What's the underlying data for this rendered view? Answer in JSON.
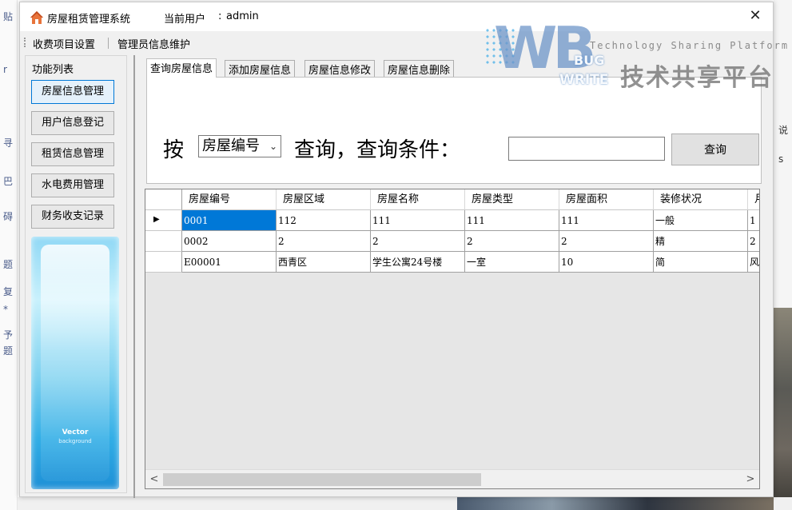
{
  "background": {
    "left_fragments": [
      "贴",
      "r",
      "寻",
      "巴",
      "碍",
      "题",
      "复",
      "*",
      "予",
      "题"
    ],
    "right_fragments": [
      "说",
      "s"
    ]
  },
  "window": {
    "title": "房屋租赁管理系统",
    "user_label": "当前用户",
    "user_separator": ":",
    "user_name": "admin",
    "close_glyph": "✕"
  },
  "menu": {
    "items": [
      {
        "label": "收费项目设置"
      },
      {
        "label": "管理员信息维护"
      }
    ]
  },
  "sidebar": {
    "title": "功能列表",
    "items": [
      {
        "label": "房屋信息管理",
        "active": true
      },
      {
        "label": "用户信息登记"
      },
      {
        "label": "租赁信息管理"
      },
      {
        "label": "水电费用管理"
      },
      {
        "label": "财务收支记录"
      }
    ],
    "banner": {
      "line1": "Vector",
      "line2": "background"
    }
  },
  "tabs": [
    {
      "label": "查询房屋信息",
      "active": true
    },
    {
      "label": "添加房屋信息"
    },
    {
      "label": "房屋信息修改"
    },
    {
      "label": "房屋信息删除"
    }
  ],
  "query": {
    "by_label": "按",
    "field_selected": "房屋编号",
    "condition_label": "查询，查询条件：",
    "input_value": "",
    "button_label": "查询"
  },
  "grid": {
    "columns": [
      "房屋编号",
      "房屋区域",
      "房屋名称",
      "房屋类型",
      "房屋面积",
      "装修状况",
      "月"
    ],
    "rows": [
      [
        "0001",
        "112",
        "111",
        "111",
        "111",
        "一般",
        "1"
      ],
      [
        "0002",
        "2",
        "2",
        "2",
        "2",
        "精",
        "2"
      ],
      [
        "E00001",
        "西青区",
        "学生公寓24号楼",
        "一室",
        "10",
        "简",
        "风"
      ]
    ],
    "current_row_marker": "▶",
    "scroll_left": "<",
    "scroll_right": ">"
  },
  "watermark": {
    "tagline": "Technology Sharing Platform",
    "bug": "BUG",
    "write": "WRITE",
    "cn": "技术共享平台"
  },
  "colors": {
    "selection": "#0078d7",
    "window_bg": "#f0f0f0",
    "grid_empty": "#e6e6e6"
  }
}
